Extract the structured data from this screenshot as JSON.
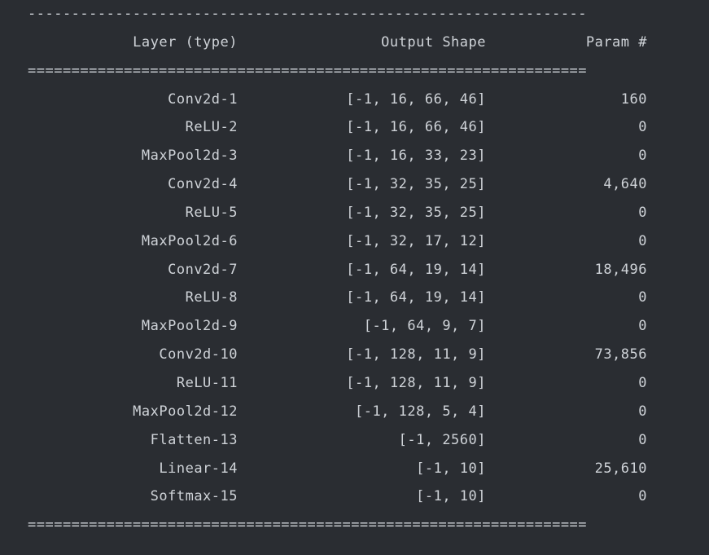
{
  "rule_dash": "----------------------------------------------------------------",
  "rule_eq": "================================================================",
  "header": {
    "c1": "Layer (type)",
    "c2": "Output Shape",
    "c3": "Param #"
  },
  "rows": [
    {
      "c1": "Conv2d-1",
      "c2": "[-1, 16, 66, 46]",
      "c3": "160"
    },
    {
      "c1": "ReLU-2",
      "c2": "[-1, 16, 66, 46]",
      "c3": "0"
    },
    {
      "c1": "MaxPool2d-3",
      "c2": "[-1, 16, 33, 23]",
      "c3": "0"
    },
    {
      "c1": "Conv2d-4",
      "c2": "[-1, 32, 35, 25]",
      "c3": "4,640"
    },
    {
      "c1": "ReLU-5",
      "c2": "[-1, 32, 35, 25]",
      "c3": "0"
    },
    {
      "c1": "MaxPool2d-6",
      "c2": "[-1, 32, 17, 12]",
      "c3": "0"
    },
    {
      "c1": "Conv2d-7",
      "c2": "[-1, 64, 19, 14]",
      "c3": "18,496"
    },
    {
      "c1": "ReLU-8",
      "c2": "[-1, 64, 19, 14]",
      "c3": "0"
    },
    {
      "c1": "MaxPool2d-9",
      "c2": "[-1, 64, 9, 7]",
      "c3": "0"
    },
    {
      "c1": "Conv2d-10",
      "c2": "[-1, 128, 11, 9]",
      "c3": "73,856"
    },
    {
      "c1": "ReLU-11",
      "c2": "[-1, 128, 11, 9]",
      "c3": "0"
    },
    {
      "c1": "MaxPool2d-12",
      "c2": "[-1, 128, 5, 4]",
      "c3": "0"
    },
    {
      "c1": "Flatten-13",
      "c2": "[-1, 2560]",
      "c3": "0"
    },
    {
      "c1": "Linear-14",
      "c2": "[-1, 10]",
      "c3": "25,610"
    },
    {
      "c1": "Softmax-15",
      "c2": "[-1, 10]",
      "c3": "0"
    }
  ],
  "chart_data": {
    "type": "table",
    "columns": [
      "Layer (type)",
      "Output Shape",
      "Param #"
    ],
    "rows": [
      [
        "Conv2d-1",
        "[-1, 16, 66, 46]",
        160
      ],
      [
        "ReLU-2",
        "[-1, 16, 66, 46]",
        0
      ],
      [
        "MaxPool2d-3",
        "[-1, 16, 33, 23]",
        0
      ],
      [
        "Conv2d-4",
        "[-1, 32, 35, 25]",
        4640
      ],
      [
        "ReLU-5",
        "[-1, 32, 35, 25]",
        0
      ],
      [
        "MaxPool2d-6",
        "[-1, 32, 17, 12]",
        0
      ],
      [
        "Conv2d-7",
        "[-1, 64, 19, 14]",
        18496
      ],
      [
        "ReLU-8",
        "[-1, 64, 19, 14]",
        0
      ],
      [
        "MaxPool2d-9",
        "[-1, 64, 9, 7]",
        0
      ],
      [
        "Conv2d-10",
        "[-1, 128, 11, 9]",
        73856
      ],
      [
        "ReLU-11",
        "[-1, 128, 11, 9]",
        0
      ],
      [
        "MaxPool2d-12",
        "[-1, 128, 5, 4]",
        0
      ],
      [
        "Flatten-13",
        "[-1, 2560]",
        0
      ],
      [
        "Linear-14",
        "[-1, 10]",
        25610
      ],
      [
        "Softmax-15",
        "[-1, 10]",
        0
      ]
    ]
  }
}
